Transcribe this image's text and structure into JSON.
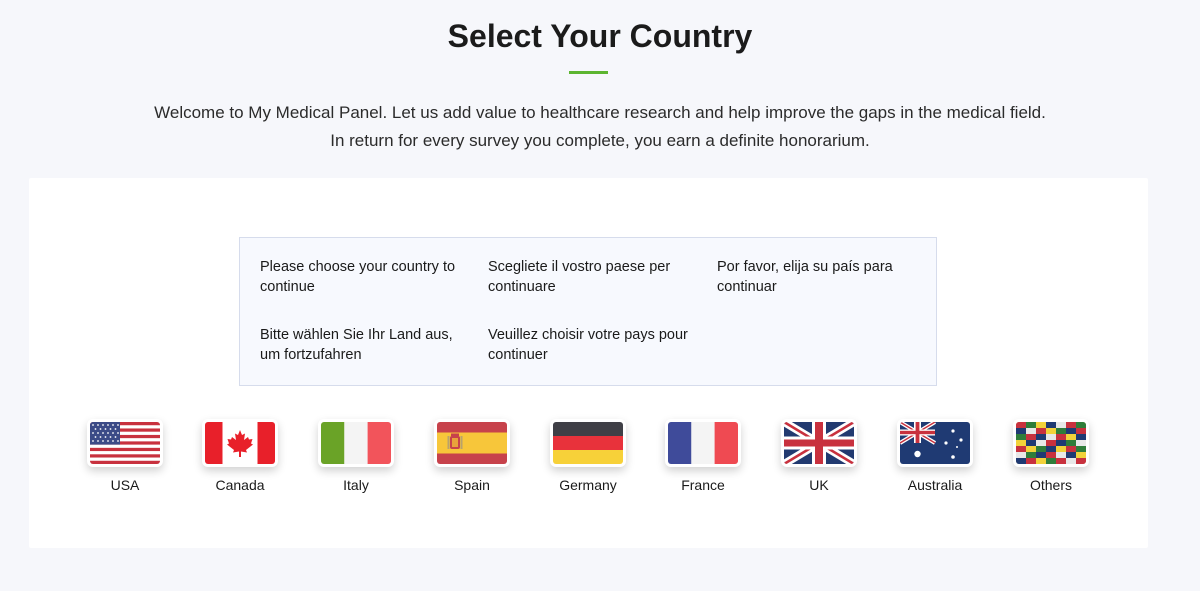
{
  "header": {
    "title": "Select Your Country",
    "intro_line1": "Welcome to My Medical Panel. Let us add value to healthcare research and help improve the gaps in the medical field.",
    "intro_line2": "In return for every survey you complete, you earn a definite honorarium."
  },
  "notice": {
    "messages": [
      "Please choose your country to continue",
      "Scegliete il vostro paese per continuare",
      "Por favor, elija su país para continuar",
      "Bitte wählen Sie Ihr Land aus, um fortzufahren",
      "Veuillez choisir votre pays pour continuer"
    ]
  },
  "countries": [
    {
      "label": "USA",
      "icon": "usa-flag-icon"
    },
    {
      "label": "Canada",
      "icon": "canada-flag-icon"
    },
    {
      "label": "Italy",
      "icon": "italy-flag-icon"
    },
    {
      "label": "Spain",
      "icon": "spain-flag-icon"
    },
    {
      "label": "Germany",
      "icon": "germany-flag-icon"
    },
    {
      "label": "France",
      "icon": "france-flag-icon"
    },
    {
      "label": "UK",
      "icon": "uk-flag-icon"
    },
    {
      "label": "Australia",
      "icon": "australia-flag-icon"
    },
    {
      "label": "Others",
      "icon": "world-flags-icon"
    }
  ],
  "colors": {
    "accent": "#5cb530",
    "background": "#f6f7fb",
    "notice_bg": "#f7f9fe"
  }
}
